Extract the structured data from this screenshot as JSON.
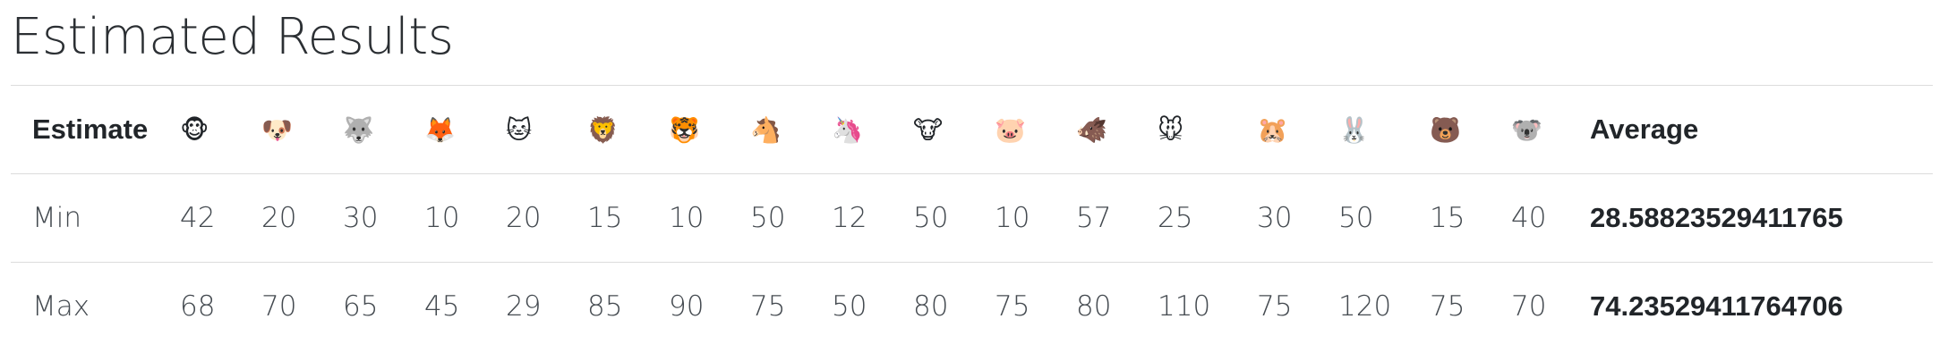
{
  "title": "Estimated Results",
  "table": {
    "header": {
      "estimate_label": "Estimate",
      "average_label": "Average"
    },
    "columns": [
      {
        "emoji": "🐵",
        "icon": "monkey-face-icon"
      },
      {
        "emoji": "🐶",
        "icon": "dog-face-icon"
      },
      {
        "emoji": "🐺",
        "icon": "wolf-face-icon"
      },
      {
        "emoji": "🦊",
        "icon": "fox-face-icon"
      },
      {
        "emoji": "🐱",
        "icon": "cat-face-icon"
      },
      {
        "emoji": "🦁",
        "icon": "lion-face-icon"
      },
      {
        "emoji": "🐯",
        "icon": "tiger-face-icon"
      },
      {
        "emoji": "🐴",
        "icon": "horse-face-icon"
      },
      {
        "emoji": "🦄",
        "icon": "unicorn-face-icon"
      },
      {
        "emoji": "🐮",
        "icon": "cow-face-icon"
      },
      {
        "emoji": "🐷",
        "icon": "pig-face-icon"
      },
      {
        "emoji": "🐗",
        "icon": "boar-icon"
      },
      {
        "emoji": "🐭",
        "icon": "mouse-face-icon"
      },
      {
        "emoji": "🐹",
        "icon": "hamster-face-icon"
      },
      {
        "emoji": "🐰",
        "icon": "rabbit-face-icon"
      },
      {
        "emoji": "🐻",
        "icon": "bear-face-icon"
      },
      {
        "emoji": "🐨",
        "icon": "koala-icon"
      }
    ],
    "rows": [
      {
        "label": "Min",
        "values": [
          "42",
          "20",
          "30",
          "10",
          "20",
          "15",
          "10",
          "50",
          "12",
          "50",
          "10",
          "57",
          "25",
          "30",
          "50",
          "15",
          "40"
        ],
        "average": "28.58823529411765"
      },
      {
        "label": "Max",
        "values": [
          "68",
          "70",
          "65",
          "45",
          "29",
          "85",
          "90",
          "75",
          "50",
          "80",
          "75",
          "80",
          "110",
          "75",
          "120",
          "75",
          "70"
        ],
        "average": "74.23529411764706"
      }
    ]
  }
}
